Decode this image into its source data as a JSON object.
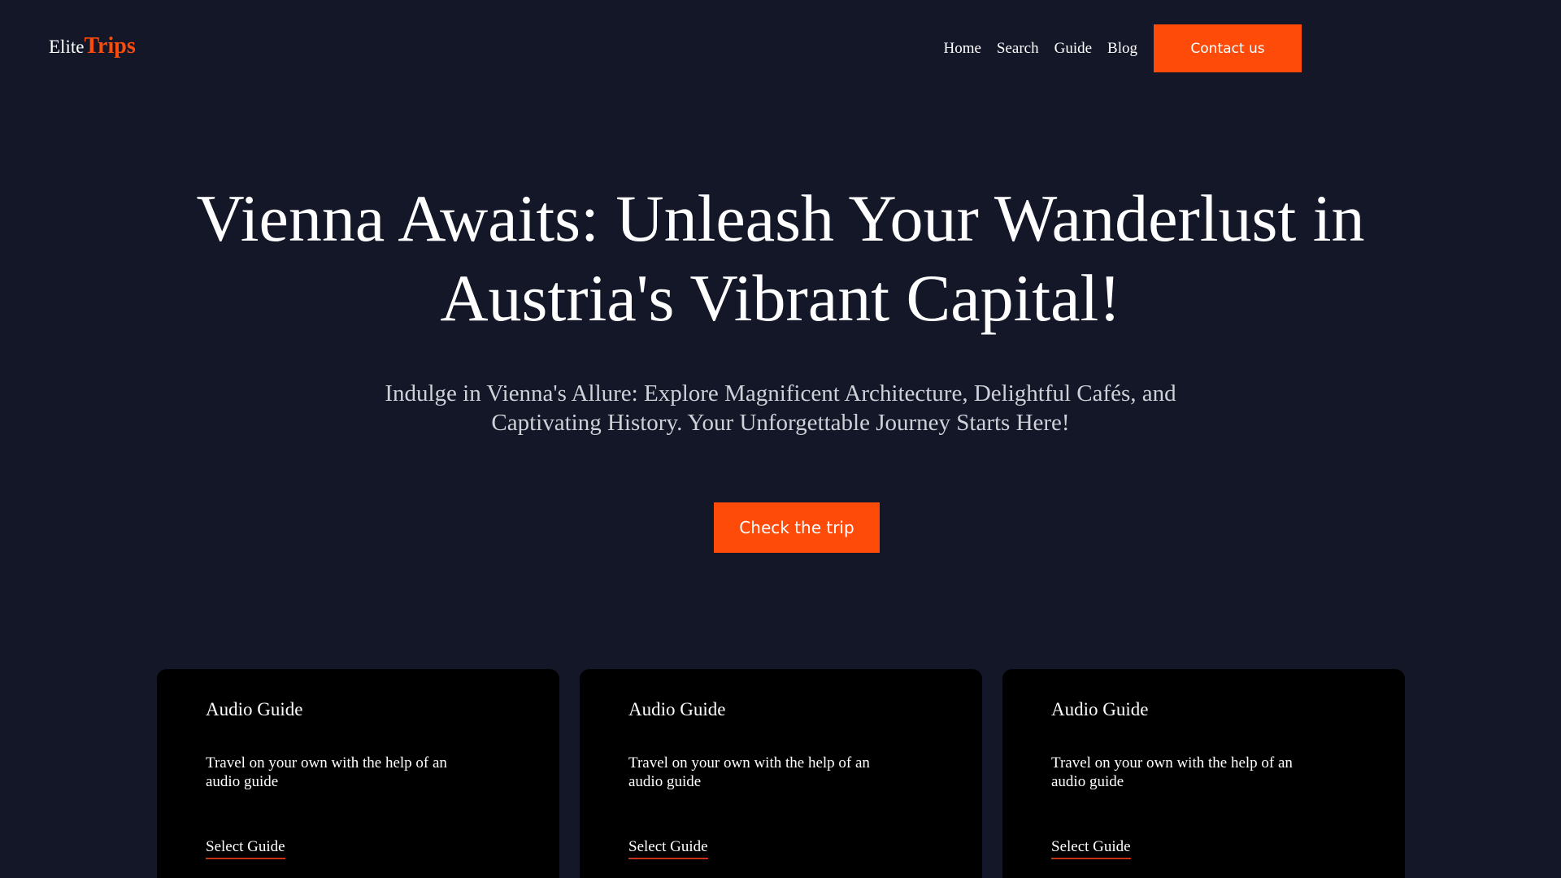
{
  "brand": {
    "name_part1": "Elite",
    "name_part2": "Trips"
  },
  "nav": {
    "items": [
      {
        "label": "Home"
      },
      {
        "label": "Search"
      },
      {
        "label": "Guide"
      },
      {
        "label": "Blog"
      }
    ],
    "contact_label": "Contact us"
  },
  "hero": {
    "title_line1": "Vienna Awaits: Unleash Your Wanderlust in",
    "title_line2": "Austria's Vibrant Capital!",
    "subtitle_line1": "Indulge in Vienna's Allure: Explore Magnificent Architecture, Delightful Cafés, and",
    "subtitle_line2": "Captivating History. Your Unforgettable Journey Starts Here!",
    "cta_label": "Check the trip"
  },
  "cards": [
    {
      "title": "Audio Guide",
      "description_line1": "Travel on your own with the help of an",
      "description_line2": "audio guide",
      "link_label": "Select Guide"
    },
    {
      "title": "Audio Guide",
      "description_line1": "Travel on your own with the help of an",
      "description_line2": "audio guide",
      "link_label": "Select Guide"
    },
    {
      "title": "Audio Guide",
      "description_line1": "Travel on your own with the help of an",
      "description_line2": "audio guide",
      "link_label": "Select Guide"
    }
  ],
  "colors": {
    "background": "#131728",
    "accent": "#ff4b0a",
    "card_background": "#000000",
    "link_underline": "#c8321a"
  }
}
